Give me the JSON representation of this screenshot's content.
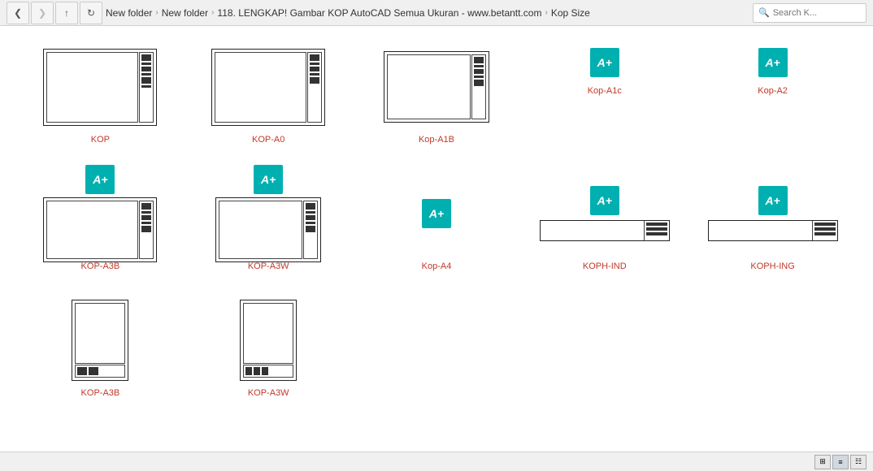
{
  "topbar": {
    "breadcrumb": [
      "New folder",
      "New folder",
      "118. LENGKAP! Gambar KOP AutoCAD Semua Ukuran - www.betantt.com",
      "Kop Size"
    ],
    "search_placeholder": "Search K..."
  },
  "files": [
    {
      "id": "kop",
      "name": "KOP",
      "type": "dwg-landscape",
      "color": "red"
    },
    {
      "id": "kop-a0",
      "name": "KOP-A0",
      "type": "dwg-landscape",
      "color": "red"
    },
    {
      "id": "kop-a1b",
      "name": "Kop-A1B",
      "type": "dwg-landscape",
      "color": "red"
    },
    {
      "id": "kop-a1c",
      "name": "Kop-A1c",
      "type": "dwg-icon",
      "color": "red"
    },
    {
      "id": "kop-a2",
      "name": "Kop-A2",
      "type": "dwg-icon",
      "color": "red"
    },
    {
      "id": "kop-a3b",
      "name": "KOP-A3B",
      "type": "dwg-landscape",
      "color": "red"
    },
    {
      "id": "kop-a3w",
      "name": "KOP-A3W",
      "type": "dwg-landscape",
      "color": "red"
    },
    {
      "id": "kop-a4",
      "name": "Kop-A4",
      "type": "dwg-icon",
      "color": "red"
    },
    {
      "id": "koph-ind",
      "name": "KOPH-IND",
      "type": "dwg-icon",
      "color": "red"
    },
    {
      "id": "koph-ing",
      "name": "KOPH-ING",
      "type": "dwg-icon",
      "color": "red"
    },
    {
      "id": "kop-a3b-port",
      "name": "KOP-A3B",
      "type": "dwg-portrait",
      "color": "red"
    },
    {
      "id": "kop-a3w-port",
      "name": "KOP-A3W",
      "type": "dwg-portrait",
      "color": "red"
    }
  ],
  "statusbar": {
    "view_grid_label": "⊞",
    "view_list_label": "≡",
    "view_detail_label": "▤"
  }
}
